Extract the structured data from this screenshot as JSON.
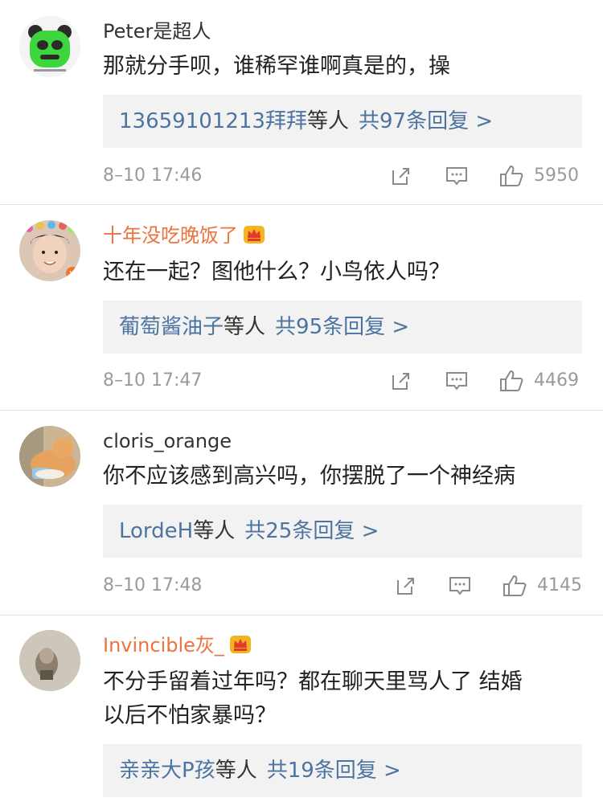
{
  "comments": [
    {
      "username": "Peter是超人",
      "content": "那就分手呗，谁稀罕谁啊真是的，操",
      "reply_names": "13659101213拜拜",
      "reply_suffix": "等人",
      "reply_count": "共97条回复 >",
      "time": "8–10 17:46",
      "likes": "5950"
    },
    {
      "username": "十年没吃晚饭了",
      "content": "还在一起？图他什么？小鸟依人吗？",
      "reply_names": "葡萄酱油子",
      "reply_suffix": "等人",
      "reply_count": "共95条回复 >",
      "time": "8–10 17:47",
      "likes": "4469"
    },
    {
      "username": "cloris_orange",
      "content": "你不应该感到高兴吗，你摆脱了一个神经病",
      "reply_names": "LordeH",
      "reply_suffix": "等人",
      "reply_count": "共25条回复 >",
      "time": "8–10 17:48",
      "likes": "4145"
    },
    {
      "username": "Invincible灰_",
      "content_line1": "不分手留着过年吗？都在聊天里骂人了 结婚",
      "content_line2": "以后不怕家暴吗？",
      "reply_names": "亲亲大P孩",
      "reply_suffix": "等人",
      "reply_count": "共19条回复 >"
    }
  ],
  "icons": {
    "share": "share-icon",
    "comment": "comment-icon",
    "like": "thumbs-up-icon",
    "crown": "crown-badge-icon"
  },
  "colors": {
    "link": "#4d74a1",
    "vip_name": "#eb7340",
    "meta": "#9a9a9a"
  }
}
